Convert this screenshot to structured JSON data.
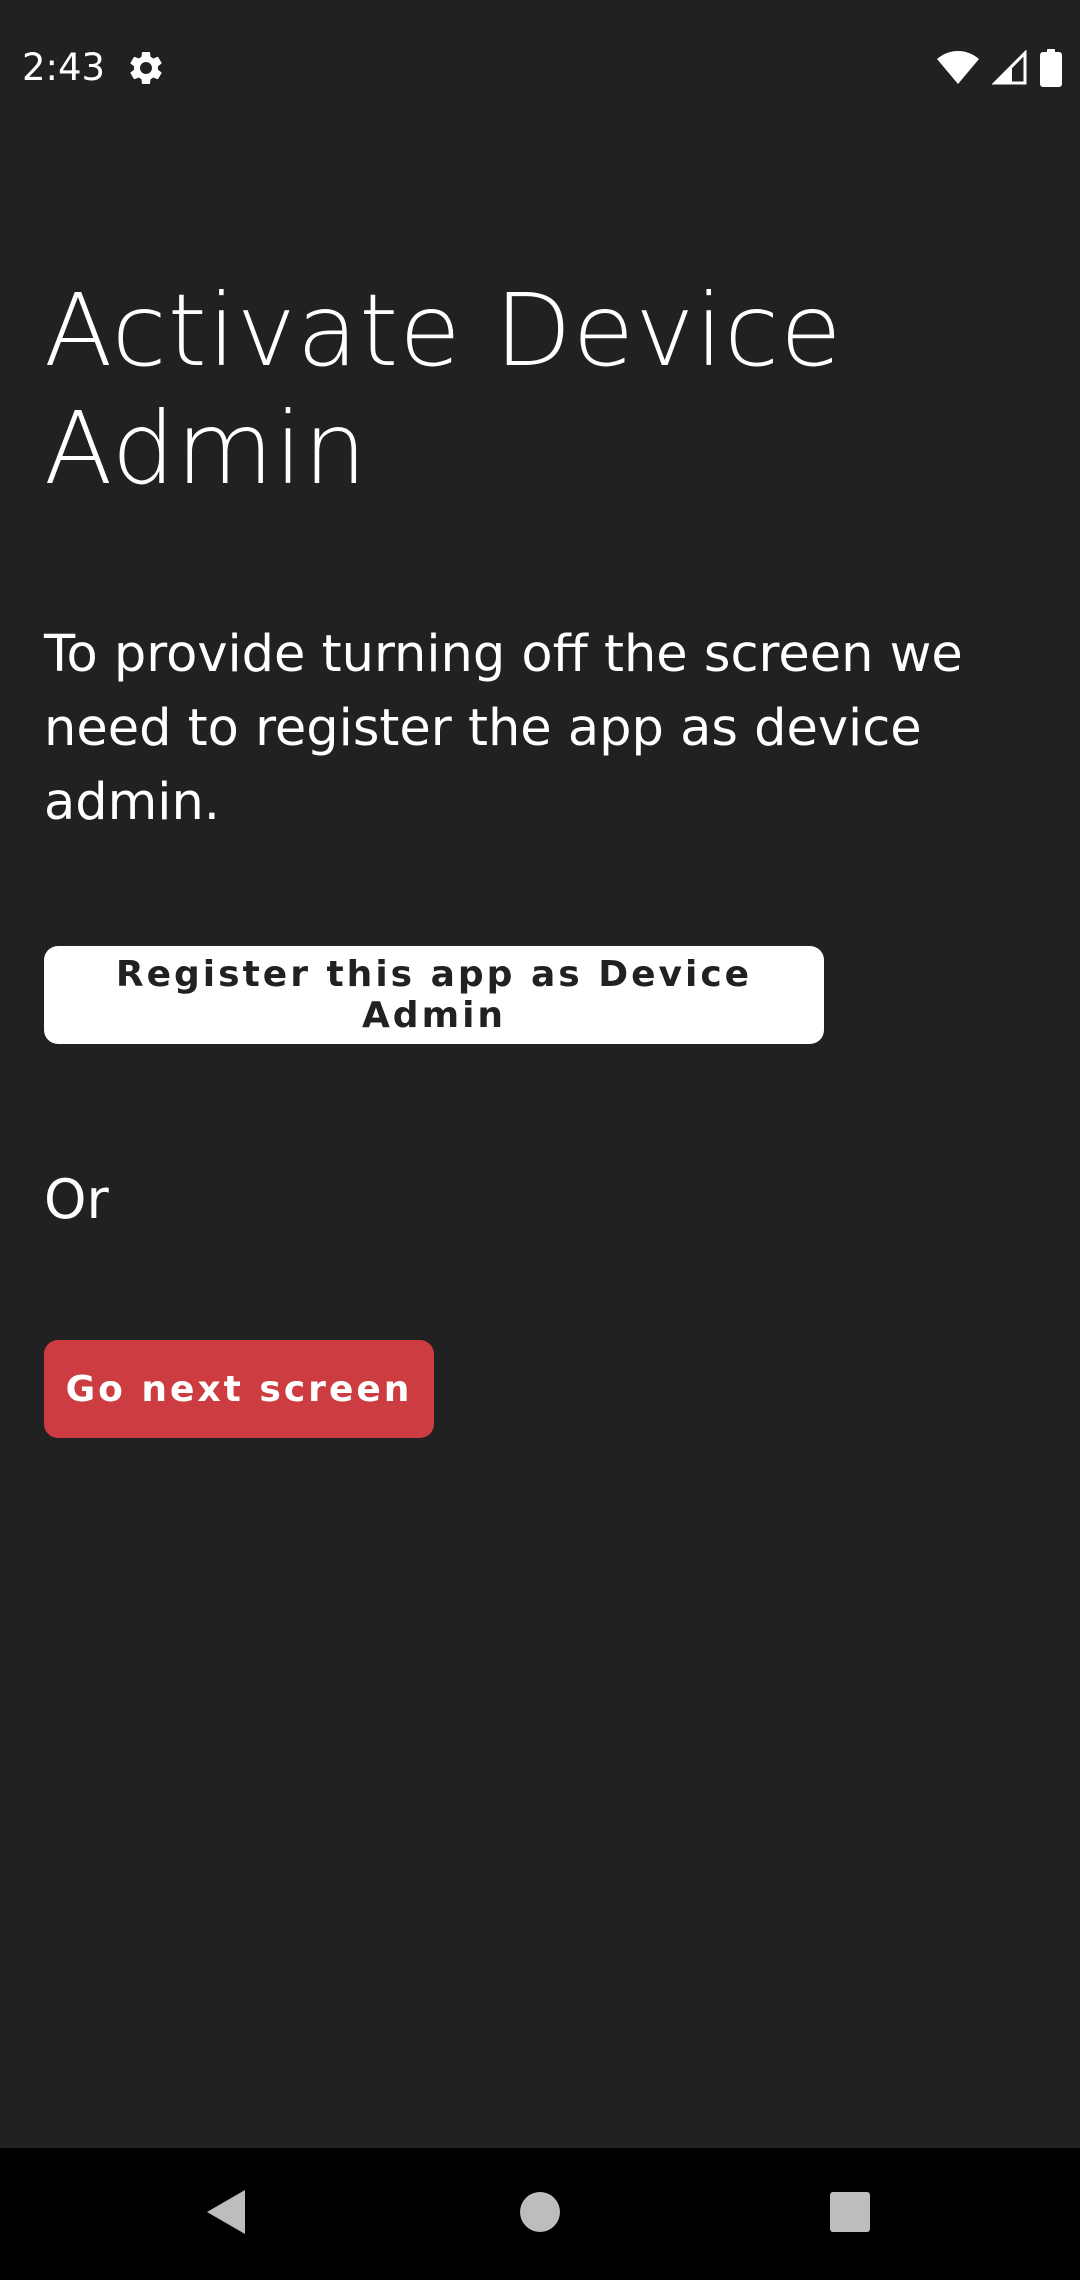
{
  "status_bar": {
    "time": "2:43",
    "left_icons": [
      "gear-icon"
    ],
    "right_icons": [
      "wifi-icon",
      "cell-signal-icon",
      "battery-icon"
    ]
  },
  "main": {
    "title": "Activate Device Admin",
    "description": "To provide turning off the screen we need to register the app as device admin.",
    "register_button_label": "Register this app as Device Admin",
    "or_label": "Or",
    "next_button_label": "Go next screen"
  },
  "nav_bar": {
    "buttons": [
      "back-icon",
      "home-icon",
      "recents-icon"
    ]
  },
  "colors": {
    "background": "#212121",
    "register_button_bg": "#ffffff",
    "next_button_bg": "#cc3c40",
    "nav_bar_bg": "#000000",
    "text": "#ffffff"
  }
}
